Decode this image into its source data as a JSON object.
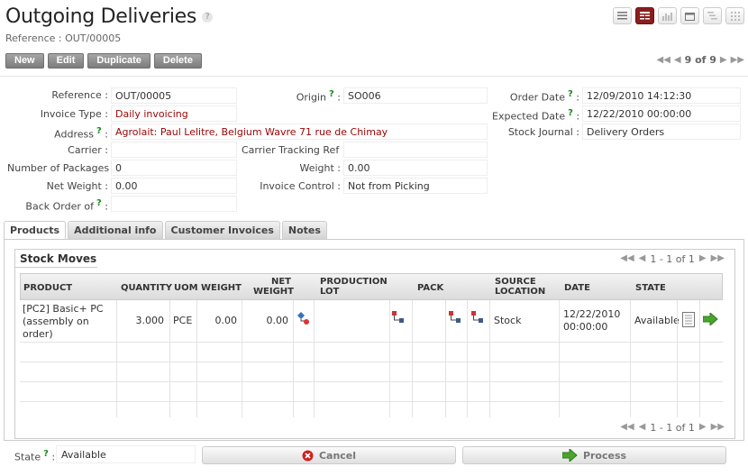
{
  "header": {
    "title": "Outgoing Deliveries",
    "help": "?",
    "subtitle": "Reference : OUT/00005"
  },
  "view_switcher": [
    "list-view-icon",
    "form-view-icon",
    "graph-view-icon",
    "calendar-view-icon",
    "gantt-view-icon",
    "kanban-view-icon"
  ],
  "toolbar": {
    "new": "New",
    "edit": "Edit",
    "duplicate": "Duplicate",
    "delete": "Delete",
    "pager": "9 of 9"
  },
  "form": {
    "reference": {
      "label": "Reference :",
      "value": "OUT/00005"
    },
    "invoice_type": {
      "label": "Invoice Type :",
      "value": "Daily invoicing"
    },
    "address": {
      "label": "Address",
      "value": "Agrolait: Paul Lelitre, Belgium Wavre 71 rue de Chimay"
    },
    "carrier": {
      "label": "Carrier :",
      "value": ""
    },
    "num_packages": {
      "label": "Number of Packages :",
      "value": "0"
    },
    "net_weight": {
      "label": "Net Weight :",
      "value": "0.00"
    },
    "back_order": {
      "label": "Back Order of",
      "value": ""
    },
    "origin": {
      "label": "Origin",
      "value": "SO006"
    },
    "carrier_tracking": {
      "label": "Carrier Tracking Ref :",
      "value": ""
    },
    "weight": {
      "label": "Weight :",
      "value": "0.00"
    },
    "invoice_control": {
      "label": "Invoice Control :",
      "value": "Not from Picking"
    },
    "order_date": {
      "label": "Order Date",
      "value": "12/09/2010 14:12:30"
    },
    "expected_date": {
      "label": "Expected Date",
      "value": "12/22/2010 00:00:00"
    },
    "stock_journal": {
      "label": "Stock Journal :",
      "value": "Delivery Orders"
    }
  },
  "tabs": [
    "Products",
    "Additional info",
    "Customer Invoices",
    "Notes"
  ],
  "stock_moves": {
    "title": "Stock Moves",
    "pager": "1 - 1 of 1",
    "columns": {
      "product": "PRODUCT",
      "quantity": "QUANTITY",
      "uom": "UOM",
      "weight": "WEIGHT",
      "net_weight_1": "NET",
      "net_weight_2": "WEIGHT",
      "prod_lot_1": "PRODUCTION",
      "prod_lot_2": "LOT",
      "pack": "PACK",
      "source_1": "SOURCE",
      "source_2": "LOCATION",
      "date": "DATE",
      "state": "STATE"
    },
    "rows": [
      {
        "product_1": "[PC2] Basic+ PC",
        "product_2": "(assembly on",
        "product_3": "order)",
        "quantity": "3.000",
        "uom": "PCE",
        "weight": "0.00",
        "net_weight": "0.00",
        "source": "Stock",
        "date_1": "12/22/2010",
        "date_2": "00:00:00",
        "state": "Available"
      }
    ]
  },
  "footer": {
    "state_label": "State",
    "state_value": "Available",
    "cancel": "Cancel",
    "process": "Process"
  },
  "colors": {
    "accent_red": "#9a0404",
    "help_green": "#1b8a1b",
    "active_view": "#8b1d1d"
  }
}
